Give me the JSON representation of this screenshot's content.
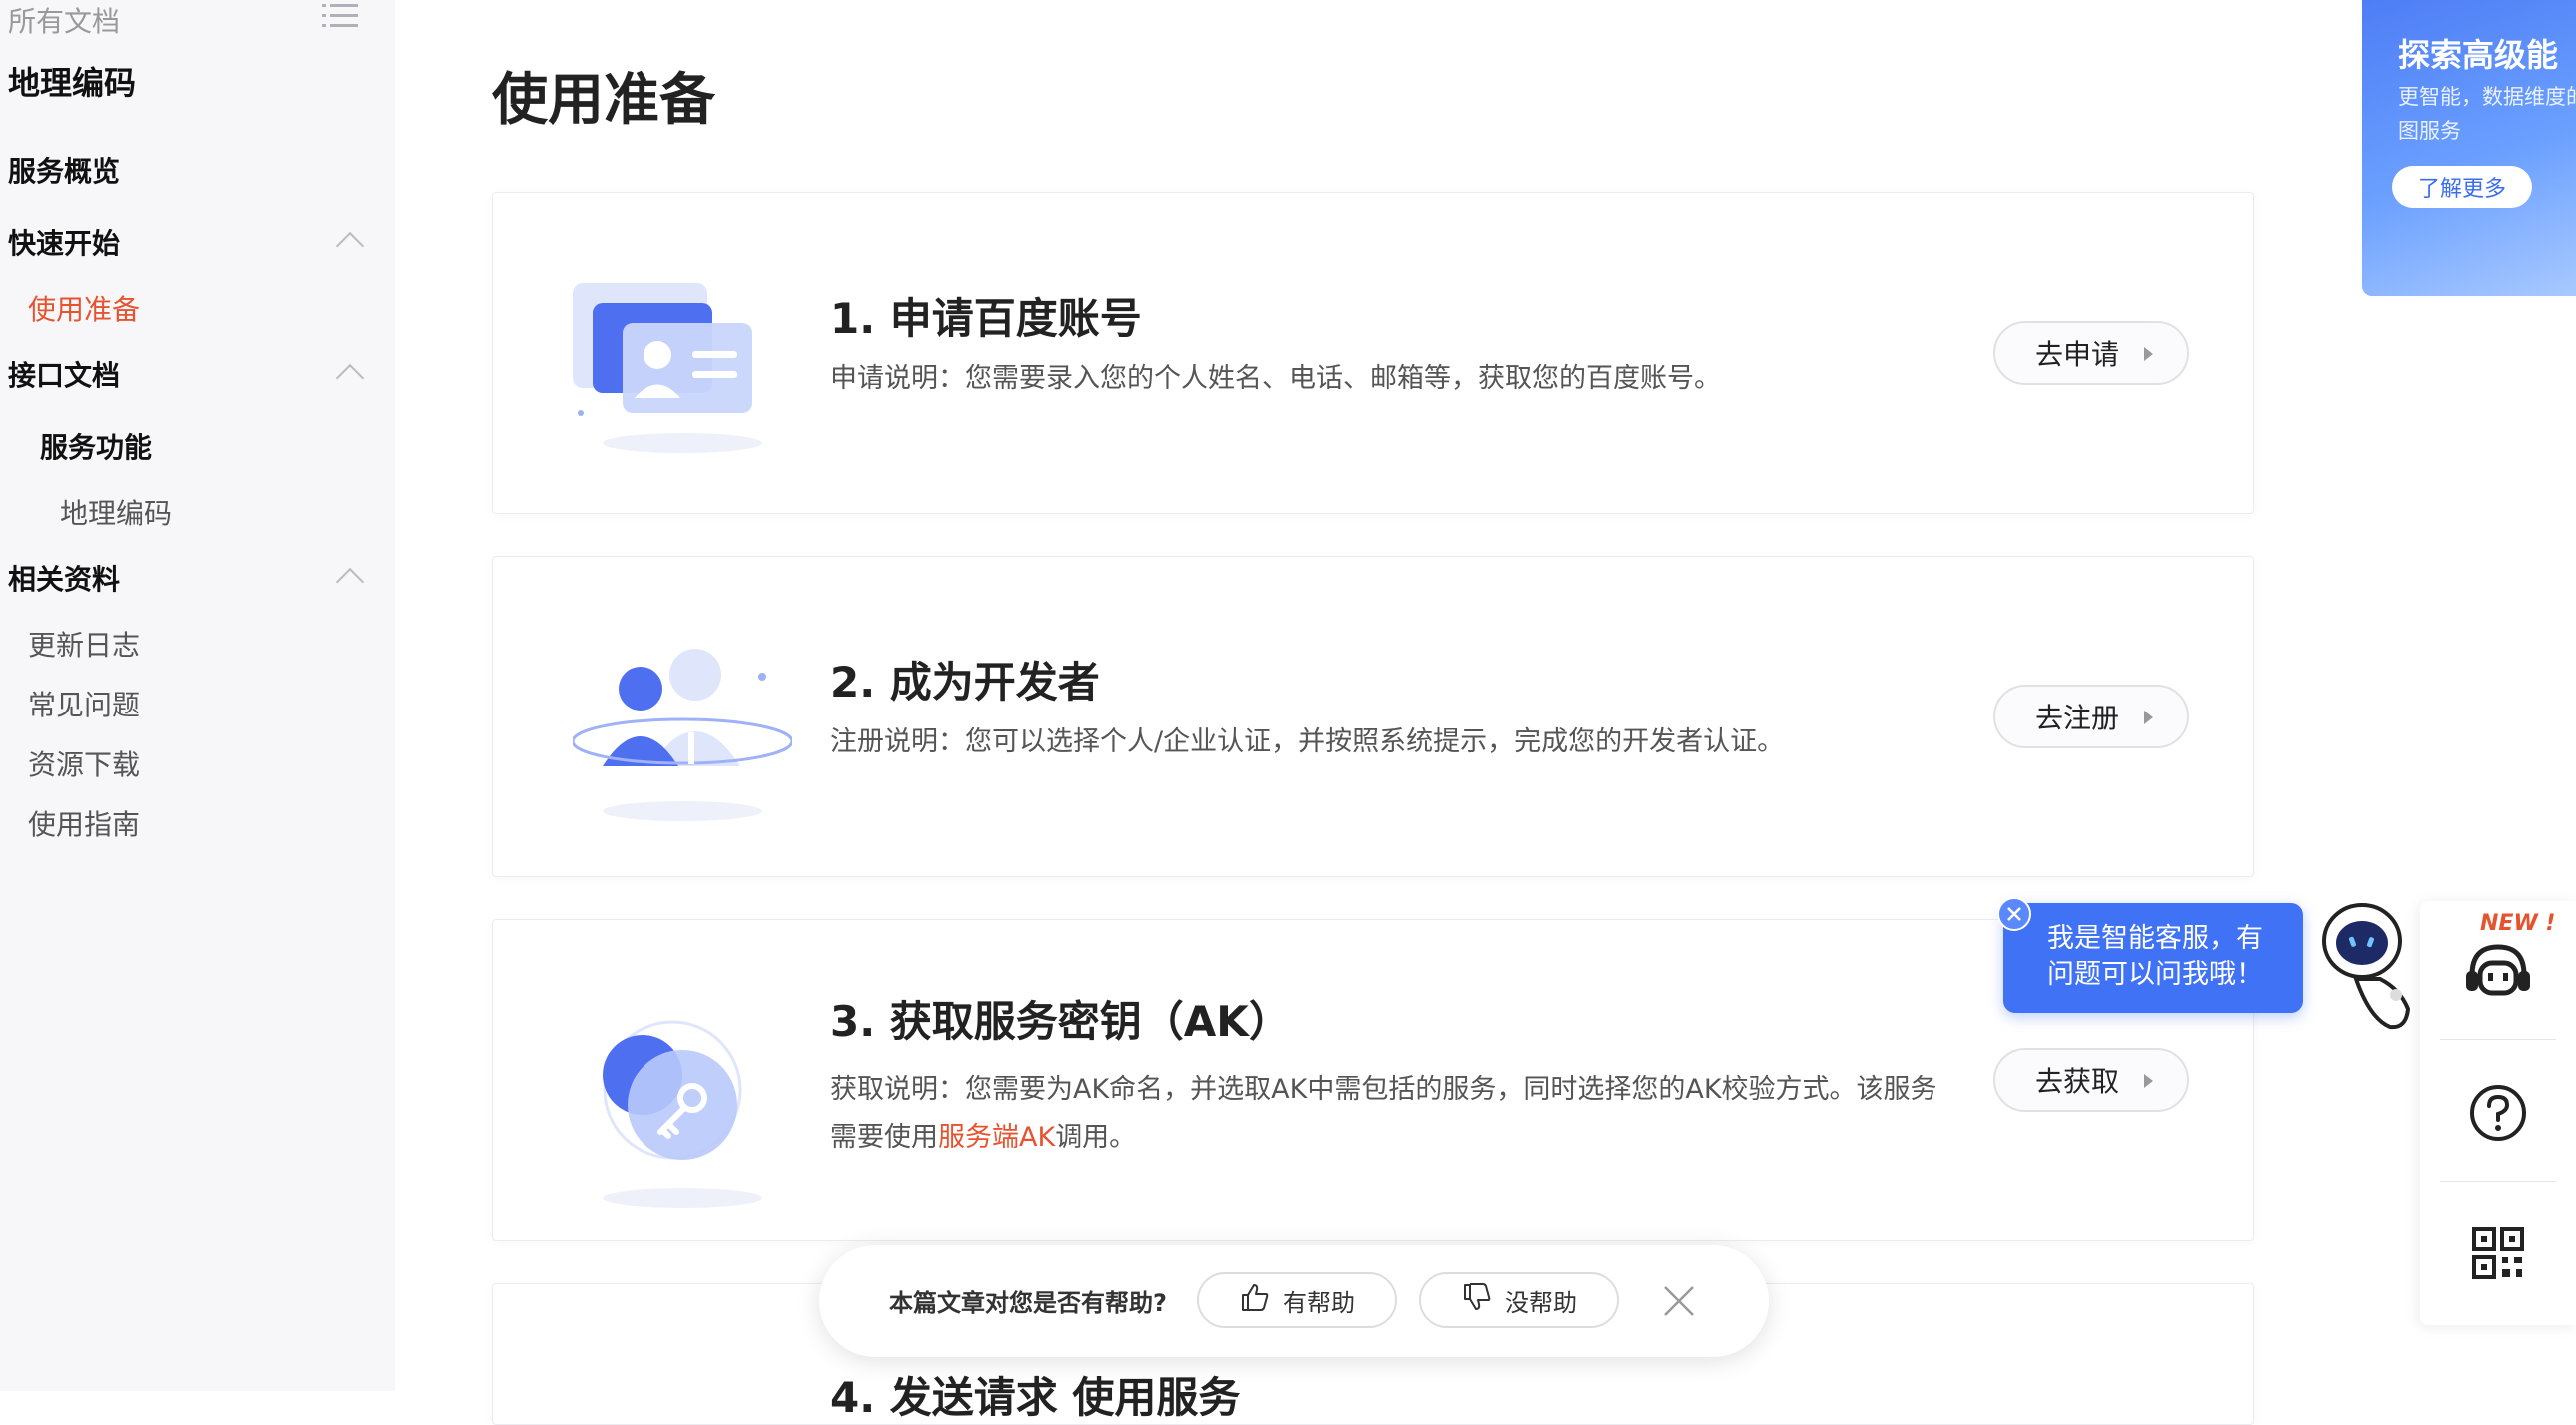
{
  "sidebar": {
    "top_label": "所有文档",
    "title": "地理编码",
    "items": [
      {
        "label": "服务概览"
      },
      {
        "label": "快速开始"
      },
      {
        "label": "使用准备"
      },
      {
        "label": "接口文档"
      },
      {
        "label": "服务功能"
      },
      {
        "label": "地理编码"
      },
      {
        "label": "相关资料"
      },
      {
        "label": "更新日志"
      },
      {
        "label": "常见问题"
      },
      {
        "label": "资源下载"
      },
      {
        "label": "使用指南"
      }
    ]
  },
  "main": {
    "title": "使用准备",
    "cards": [
      {
        "title": "1. 申请百度账号",
        "desc": "申请说明：您需要录入您的个人姓名、电话、邮箱等，获取您的百度账号。",
        "button": "去申请"
      },
      {
        "title": "2. 成为开发者",
        "desc": "注册说明：您可以选择个人/企业认证，并按照系统提示，完成您的开发者认证。",
        "button": "去注册"
      },
      {
        "title": "3. 获取服务密钥（AK）",
        "desc_before": "获取说明：您需要为AK命名，并选取AK中需包括的服务，同时选择您的AK校验方式。该服务需要使用",
        "desc_link": "服务端AK",
        "desc_after": "调用。",
        "button": "去获取"
      },
      {
        "title": "4. 发送请求 使用服务"
      }
    ]
  },
  "feedback": {
    "question": "本篇文章对您是否有帮助?",
    "yes": "有帮助",
    "no": "没帮助"
  },
  "promo": {
    "title": "探索高级能",
    "desc": "更智能，数据维度的地图服务",
    "button": "了解更多"
  },
  "chat": {
    "message": "我是智能客服，有问题可以问我哦！"
  },
  "toolbar": {
    "badge": "NEW !"
  },
  "colors": {
    "accent": "#e8532f",
    "brand_blue": "#3f72f5"
  }
}
